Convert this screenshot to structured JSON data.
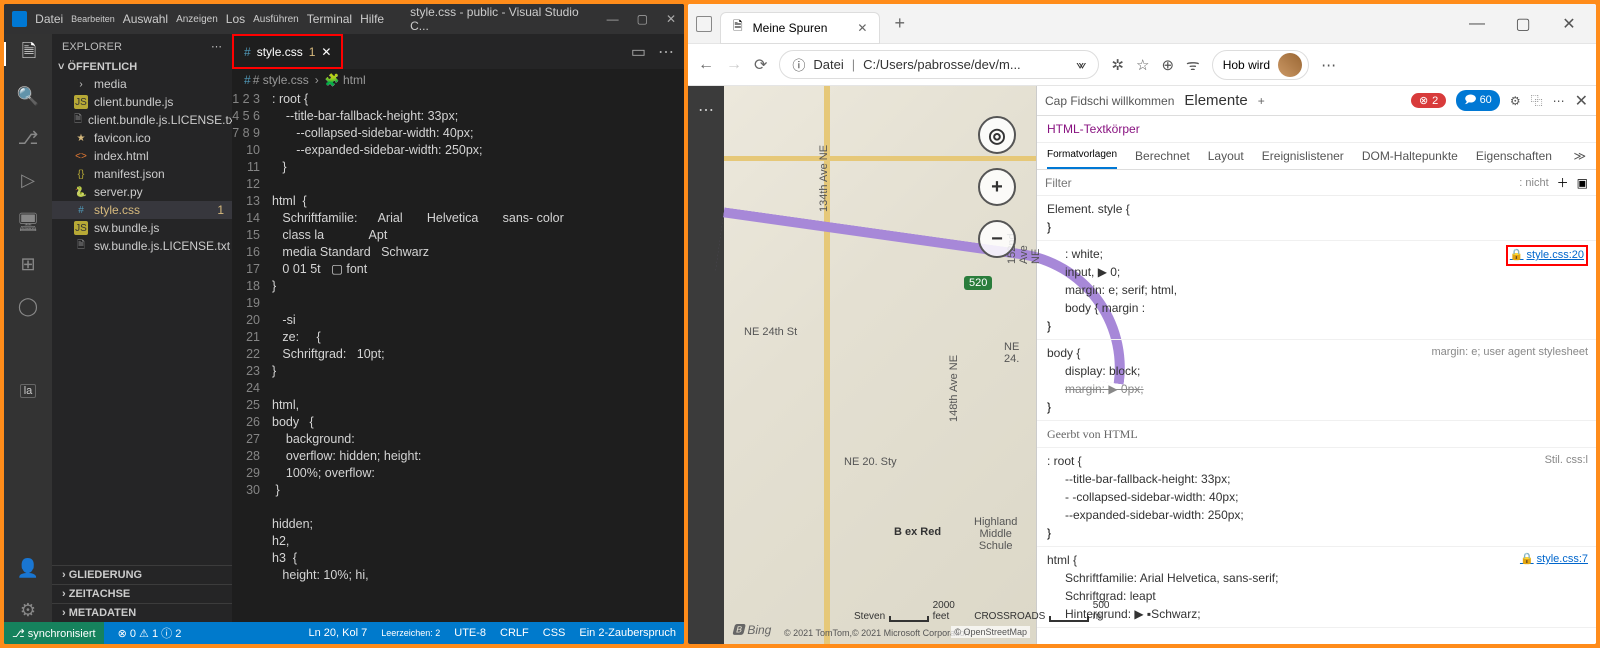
{
  "vs": {
    "title": "style.css - public - Visual Studio C...",
    "menu": [
      "Datei",
      "Bearbeiten",
      "Auswahl",
      "Anzeigen",
      "Los",
      "Ausführen",
      "Terminal",
      "Hilfe"
    ],
    "explorer_label": "EXPLORER",
    "folder": "ÖFFENTLICH",
    "files": [
      {
        "icon": "›",
        "name": "media",
        "cls": "folder"
      },
      {
        "icon": "JS",
        "name": "client.bundle.js",
        "cls": "js"
      },
      {
        "icon": "🗎",
        "name": "client.bundle.js.LICENSE.txt",
        "cls": "lic"
      },
      {
        "icon": "★",
        "name": "favicon.ico",
        "cls": "star"
      },
      {
        "icon": "<>",
        "name": "index.html",
        "cls": "html"
      },
      {
        "icon": "{}",
        "name": "manifest.json",
        "cls": "json"
      },
      {
        "icon": "🐍",
        "name": "server.py",
        "cls": "py"
      },
      {
        "icon": "#",
        "name": "style.css",
        "cls": "css",
        "mod": "1",
        "sel": true
      },
      {
        "icon": "JS",
        "name": "sw.bundle.js",
        "cls": "js"
      },
      {
        "icon": "🗎",
        "name": "sw.bundle.js.LICENSE.txt",
        "cls": "lic"
      }
    ],
    "sections": [
      "GLIEDERUNG",
      "ZEITACHSE",
      "METADATEN"
    ],
    "tab": {
      "icon": "#",
      "name": "style.css",
      "mod": "1"
    },
    "crumb": [
      "# style.css",
      "›",
      "🧩 html"
    ],
    "code": [
      ": root {",
      "    --title-bar-fallback-height: 33px;",
      "       --collapsed-sidebar-width: 40px;",
      "       --expanded-sidebar-width: 250px;",
      "   }",
      "",
      "html  {",
      "   Schriftfamilie:      Arial       Helvetica       sans- color",
      "   class la             Apt",
      "   media Standard   Schwarz",
      "   0 01 5t   ▢ font",
      "}",
      "",
      "   -si",
      "   ze:     {",
      "   Schriftgrad:   10pt;",
      "}",
      "",
      "html,",
      "body   {",
      "    background:",
      "    overflow: hidden; height:",
      "    100%; overflow:",
      " }",
      "",
      "hidden;",
      "h2,",
      "h3  {",
      "   height: 10%; hi,",
      ""
    ],
    "status": {
      "branch": "⎇ synchronisiert",
      "errors": "⊗ 0 ⚠ 1 ⓘ 2",
      "pos": "Ln 20, Kol 7",
      "spaces": "Leerzeichen: 2",
      "enc": "UTE-8",
      "eol": "CRLF",
      "lang": "CSS",
      "magic": "Ein 2-Zauberspruch"
    },
    "la_badge": "la"
  },
  "edge": {
    "tab_title": "Meine Spuren",
    "addr_prefix": "Datei",
    "addr": "C:/Users/pabrosse/dev/m...",
    "profile": "Hob wird",
    "map": {
      "badge": "520",
      "bel": "B ex Red",
      "hi": "Highland\nMiddle\nSchule",
      "ne20": "NE 20. Sty",
      "ne24": "NE 24th St",
      "ne242": "NE 24.",
      "v1": "134th Ave NE",
      "v2": "148th Ave NE",
      "v3": "152nd Ave NE",
      "scale": [
        "Steven",
        "2000 feet",
        "CROSSROADS",
        "500 m"
      ],
      "copy": "© 2021 TomTom,© 2021 Microsoft Corporation,",
      "osm": "© OpenStreetMap",
      "bing": "🅱 Bing"
    },
    "dev": {
      "welcome": "Cap Fidschi willkommen",
      "elements": "Elemente",
      "err": "2",
      "info": "60",
      "selected": "HTML-Textkörper",
      "tabs": [
        "Formatvorlagen",
        "Berechnet",
        "Layout",
        "Ereignislistener",
        "DOM-Haltepunkte",
        "Eigenschaften"
      ],
      "filter_ph": "Filter",
      "nicht": ": nicht",
      "rules": [
        {
          "sel": "Element. style {",
          "src": "",
          "body": [],
          "close": "}"
        },
        {
          "sel": "",
          "src": "style.css:20",
          "srcbox": true,
          "body": [
            "  : white;",
            "  input,     ▶  0;",
            "margin:  e;  serif;  html,",
            "  body { margin :"
          ],
          "close": "}"
        },
        {
          "sel": "body {",
          "src": "margin: e; user agent stylesheet",
          "body": [
            "display: block;",
            "margin:   ▶  0px;"
          ],
          "strike": [
            1
          ],
          "close": "}"
        },
        {
          "header": "Geerbt von HTML"
        },
        {
          "sel": ": root {",
          "src": "Stil. css:l",
          "body": [
            "--title-bar-fallback-height: 33px;",
            "- -collapsed-sidebar-width: 40px;",
            "--expanded-sidebar-width: 250px;"
          ],
          "close": "}"
        },
        {
          "sel": "html   {",
          "src": "style.css:7",
          "srclink": true,
          "body": [
            "Schriftfamilie:      Arial        Helvetica, sans-serif;",
            "Schriftgrad: leapt",
            "Hintergrund:     ▶  ▪Schwarz;"
          ],
          "close": ""
        }
      ]
    }
  }
}
